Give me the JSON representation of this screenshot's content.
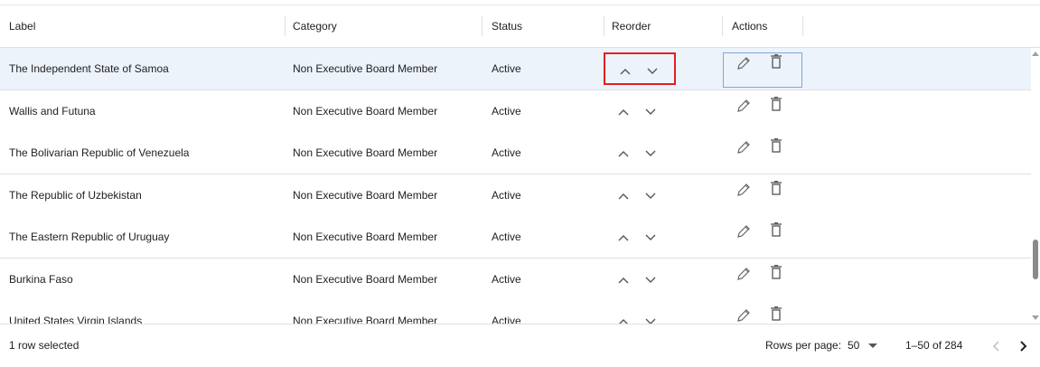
{
  "columns": {
    "label": "Label",
    "category": "Category",
    "status": "Status",
    "reorder": "Reorder",
    "actions": "Actions"
  },
  "rows": [
    {
      "label": "The Independent State of Samoa",
      "category": "Non Executive Board Member",
      "status": "Active"
    },
    {
      "label": "Wallis and Futuna",
      "category": "Non Executive Board Member",
      "status": "Active"
    },
    {
      "label": "The Bolivarian Republic of Venezuela",
      "category": "Non Executive Board Member",
      "status": "Active"
    },
    {
      "label": "The Republic of Uzbekistan",
      "category": "Non Executive Board Member",
      "status": "Active"
    },
    {
      "label": "The Eastern Republic of Uruguay",
      "category": "Non Executive Board Member",
      "status": "Active"
    },
    {
      "label": "Burkina Faso",
      "category": "Non Executive Board Member",
      "status": "Active"
    },
    {
      "label": "United States Virgin Islands",
      "category": "Non Executive Board Member",
      "status": "Active"
    }
  ],
  "selected_row_index": 0,
  "footer": {
    "selection_text": "1 row selected",
    "rows_per_page_label": "Rows per page:",
    "rows_per_page_value": "50",
    "range_text": "1–50 of 284"
  },
  "icons": {
    "move_up": "chevron-up-icon",
    "move_down": "chevron-down-icon",
    "edit": "pencil-icon",
    "delete": "trash-icon",
    "prev_page": "chevron-left-icon",
    "next_page": "chevron-right-icon"
  },
  "colors": {
    "selected_row": "#edf3fb",
    "highlight_border": "#e02020",
    "focus_border": "#7fa7d9",
    "text": "#212121"
  }
}
